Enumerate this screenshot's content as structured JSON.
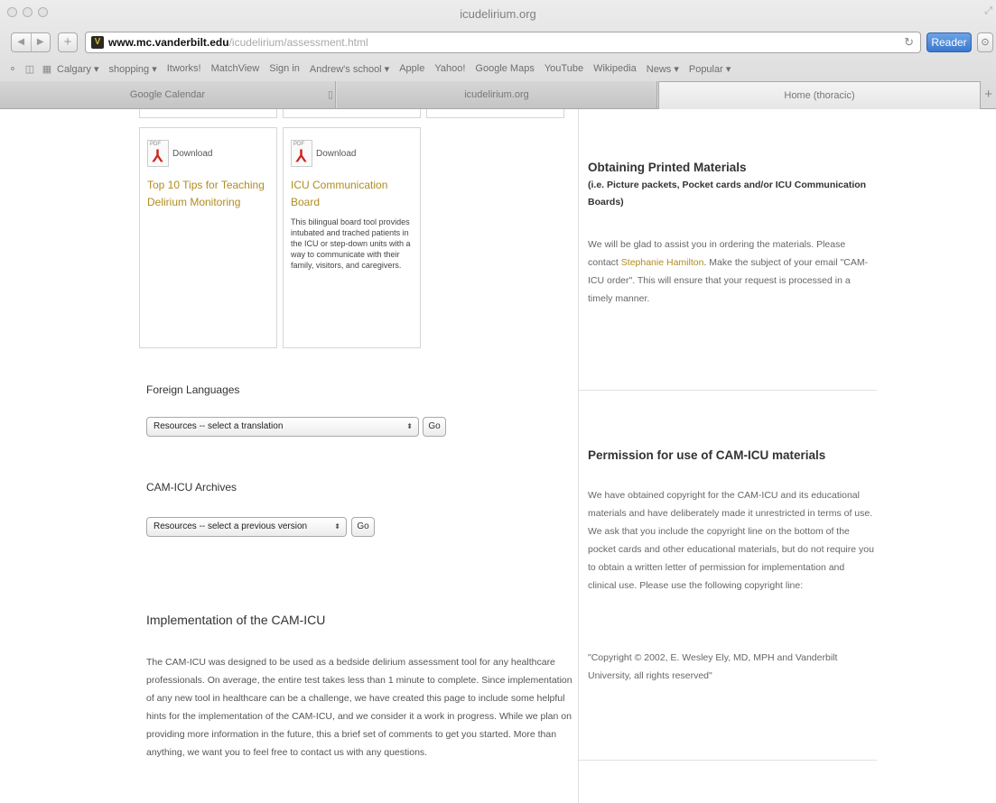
{
  "browser": {
    "window_title": "icudelirium.org",
    "url_host": "www.mc.vanderbilt.edu",
    "url_path": "/icudelirium/assessment.html",
    "reader_label": "Reader",
    "bookmarks": [
      "Calgary ▾",
      "shopping ▾",
      "Itworks!",
      "MatchView",
      "Sign in",
      "Andrew's school ▾",
      "Apple",
      "Yahoo!",
      "Google Maps",
      "YouTube",
      "Wikipedia",
      "News ▾",
      "Popular ▾"
    ],
    "tabs": [
      {
        "label": "Google Calendar"
      },
      {
        "label": "icudelirium.org"
      },
      {
        "label": "Home (thoracic)"
      }
    ]
  },
  "downloads": {
    "items": [
      {
        "download_label": "Download",
        "pdf_label": "PDF",
        "title": "Top 10 Tips for Teaching Delirium Monitoring",
        "description": ""
      },
      {
        "download_label": "Download",
        "pdf_label": "PDF",
        "title": "ICU Communication Board",
        "description": "This bilingual board tool provides intubated and trached patients in the ICU or step-down units with a way to communicate with their family, visitors, and caregivers."
      }
    ]
  },
  "foreign_languages": {
    "label": "Foreign Languages",
    "select_value": "Resources -- select a translation",
    "go_label": "Go"
  },
  "archives": {
    "label": "CAM-ICU Archives",
    "select_value": "Resources -- select a previous version",
    "go_label": "Go"
  },
  "implementation": {
    "title": "Implementation of the CAM-ICU",
    "text": "The CAM-ICU was designed to be used as a bedside delirium assessment tool for any healthcare professionals. On average, the entire test takes less than 1 minute to complete. Since implementation of any new tool in healthcare can be a challenge, we have created this page to include some helpful hints for the implementation of the CAM-ICU, and we consider it a work in progress. While we plan on providing more information in the future, this a brief set of comments to get you started. More than anything, we want you to feel free to contact us with any questions."
  },
  "sidebar": {
    "printed": {
      "title": "Obtaining Printed Materials",
      "subtitle": "(i.e. Picture packets, Pocket cards and/or ICU Communication Boards)",
      "text_before": "We will be glad to assist you in ordering the materials. Please contact ",
      "contact_name": "Stephanie Hamilton",
      "text_after": ". Make the subject of your email \"CAM-ICU order\". This will ensure that your request is processed in a timely manner."
    },
    "permission": {
      "title": "Permission for use of CAM-ICU materials",
      "text": "We have obtained copyright for the CAM-ICU and its educational materials and have deliberately made it unrestricted in terms of use.  We ask that you include the copyright line on the bottom of the pocket cards and other educational materials, but do not require you to obtain a written letter of permission for implementation and clinical use. Please use the following copyright line:",
      "copyright": "\"Copyright © 2002, E. Wesley Ely, MD, MPH and Vanderbilt University, all rights reserved\""
    }
  }
}
